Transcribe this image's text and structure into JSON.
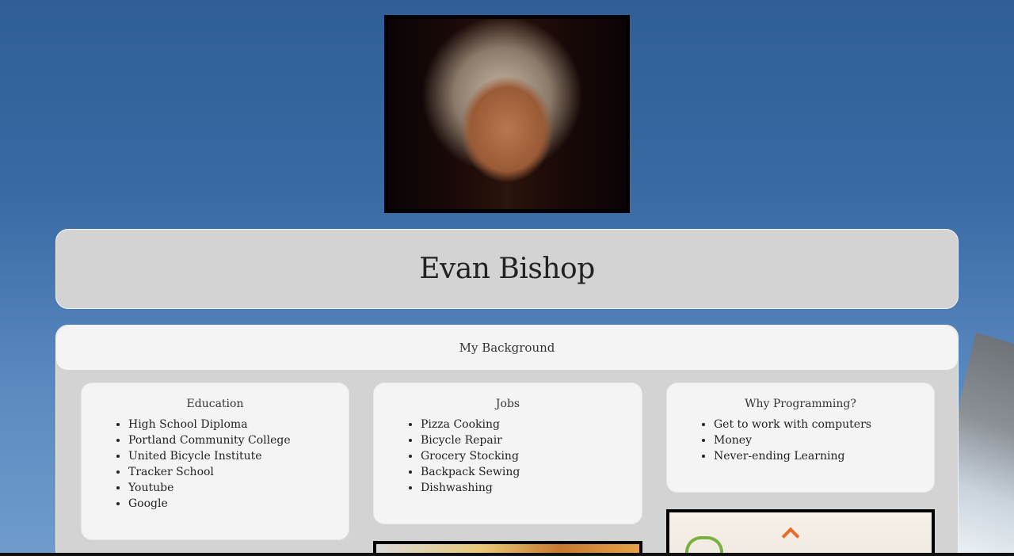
{
  "profile": {
    "photo_alt": "Portrait photo",
    "name": "Evan Bishop"
  },
  "background": {
    "heading": "My Background",
    "columns": [
      {
        "title": "Education",
        "items": [
          "High School Diploma",
          "Portland Community College",
          "United Bicycle Institute",
          "Tracker School",
          "Youtube",
          "Google"
        ]
      },
      {
        "title": "Jobs",
        "items": [
          "Pizza Cooking",
          "Bicycle Repair",
          "Grocery Stocking",
          "Backpack Sewing",
          "Dishwashing"
        ]
      },
      {
        "title": "Why Programming?",
        "items": [
          "Get to work with computers",
          "Money",
          "Never-ending Learning"
        ]
      }
    ]
  },
  "colors": {
    "card_gray": "#d3d3d3",
    "card_light": "#f4f4f4",
    "sky_blue": "#3a6aa3"
  }
}
